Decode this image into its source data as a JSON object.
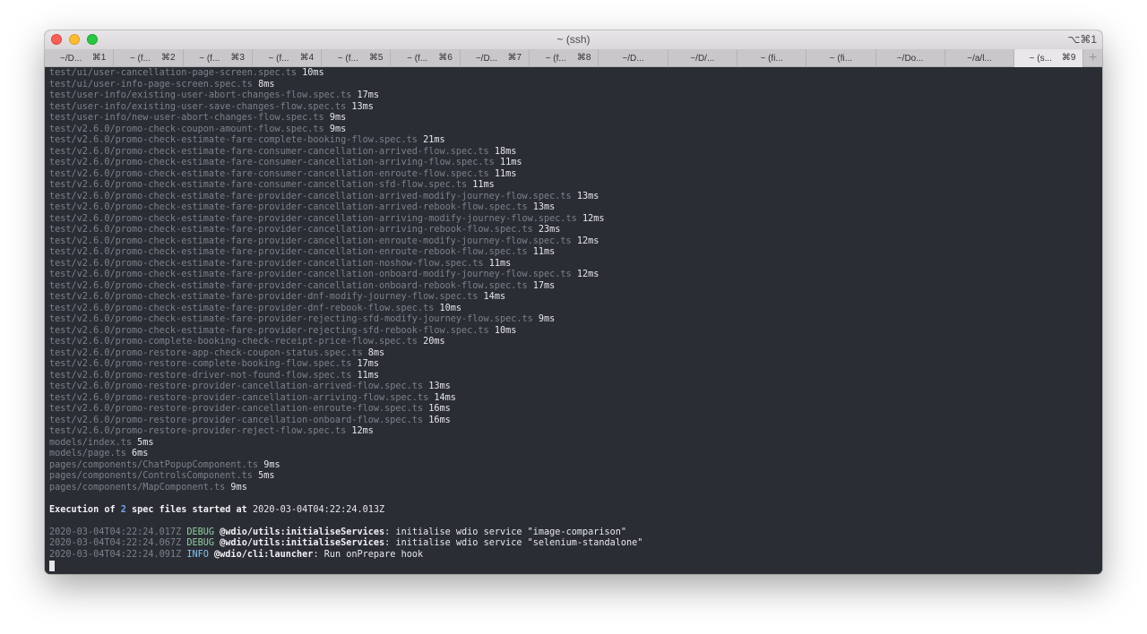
{
  "window": {
    "title": "~ (ssh)",
    "shortcut": "⌥⌘1"
  },
  "tabs": [
    {
      "label": "~/D...",
      "key": "⌘1",
      "active": false
    },
    {
      "label": "~ (f...",
      "key": "⌘2",
      "active": false
    },
    {
      "label": "~ (f...",
      "key": "⌘3",
      "active": false
    },
    {
      "label": "~ (f...",
      "key": "⌘4",
      "active": false
    },
    {
      "label": "~ (f...",
      "key": "⌘5",
      "active": false
    },
    {
      "label": "~ (f...",
      "key": "⌘6",
      "active": false
    },
    {
      "label": "~/D...",
      "key": "⌘7",
      "active": false
    },
    {
      "label": "~ (f...",
      "key": "⌘8",
      "active": false
    },
    {
      "label": "~/D...",
      "key": "",
      "active": false
    },
    {
      "label": "~/D/...",
      "key": "",
      "active": false
    },
    {
      "label": "~ (fi...",
      "key": "",
      "active": false
    },
    {
      "label": "~ (fi...",
      "key": "",
      "active": false
    },
    {
      "label": "~/Do...",
      "key": "",
      "active": false
    },
    {
      "label": "~/a/l...",
      "key": "",
      "active": false
    },
    {
      "label": "~ (s...",
      "key": "⌘9",
      "active": true
    }
  ],
  "add_tab_label": "+",
  "colors": {
    "terminal_bg": "#2b2d35",
    "path_text": "#7c8089",
    "debug": "#8fd19e",
    "info": "#7fc4f0"
  },
  "file_lines": [
    {
      "path": "test/ui/user-cancellation-page-screen.spec.ts",
      "time": "10ms"
    },
    {
      "path": "test/ui/user-info-page-screen.spec.ts",
      "time": "8ms"
    },
    {
      "path": "test/user-info/existing-user-abort-changes-flow.spec.ts",
      "time": "17ms"
    },
    {
      "path": "test/user-info/existing-user-save-changes-flow.spec.ts",
      "time": "13ms"
    },
    {
      "path": "test/user-info/new-user-abort-changes-flow.spec.ts",
      "time": "9ms"
    },
    {
      "path": "test/v2.6.0/promo-check-coupon-amount-flow.spec.ts",
      "time": "9ms"
    },
    {
      "path": "test/v2.6.0/promo-check-estimate-fare-complete-booking-flow.spec.ts",
      "time": "21ms"
    },
    {
      "path": "test/v2.6.0/promo-check-estimate-fare-consumer-cancellation-arrived-flow.spec.ts",
      "time": "18ms"
    },
    {
      "path": "test/v2.6.0/promo-check-estimate-fare-consumer-cancellation-arriving-flow.spec.ts",
      "time": "11ms"
    },
    {
      "path": "test/v2.6.0/promo-check-estimate-fare-consumer-cancellation-enroute-flow.spec.ts",
      "time": "11ms"
    },
    {
      "path": "test/v2.6.0/promo-check-estimate-fare-consumer-cancellation-sfd-flow.spec.ts",
      "time": "11ms"
    },
    {
      "path": "test/v2.6.0/promo-check-estimate-fare-provider-cancellation-arrived-modify-journey-flow.spec.ts",
      "time": "13ms"
    },
    {
      "path": "test/v2.6.0/promo-check-estimate-fare-provider-cancellation-arrived-rebook-flow.spec.ts",
      "time": "13ms"
    },
    {
      "path": "test/v2.6.0/promo-check-estimate-fare-provider-cancellation-arriving-modify-journey-flow.spec.ts",
      "time": "12ms"
    },
    {
      "path": "test/v2.6.0/promo-check-estimate-fare-provider-cancellation-arriving-rebook-flow.spec.ts",
      "time": "23ms"
    },
    {
      "path": "test/v2.6.0/promo-check-estimate-fare-provider-cancellation-enroute-modify-journey-flow.spec.ts",
      "time": "12ms"
    },
    {
      "path": "test/v2.6.0/promo-check-estimate-fare-provider-cancellation-enroute-rebook-flow.spec.ts",
      "time": "11ms"
    },
    {
      "path": "test/v2.6.0/promo-check-estimate-fare-provider-cancellation-noshow-flow.spec.ts",
      "time": "11ms"
    },
    {
      "path": "test/v2.6.0/promo-check-estimate-fare-provider-cancellation-onboard-modify-journey-flow.spec.ts",
      "time": "12ms"
    },
    {
      "path": "test/v2.6.0/promo-check-estimate-fare-provider-cancellation-onboard-rebook-flow.spec.ts",
      "time": "17ms"
    },
    {
      "path": "test/v2.6.0/promo-check-estimate-fare-provider-dnf-modify-journey-flow.spec.ts",
      "time": "14ms"
    },
    {
      "path": "test/v2.6.0/promo-check-estimate-fare-provider-dnf-rebook-flow.spec.ts",
      "time": "10ms"
    },
    {
      "path": "test/v2.6.0/promo-check-estimate-fare-provider-rejecting-sfd-modify-journey-flow.spec.ts",
      "time": "9ms"
    },
    {
      "path": "test/v2.6.0/promo-check-estimate-fare-provider-rejecting-sfd-rebook-flow.spec.ts",
      "time": "10ms"
    },
    {
      "path": "test/v2.6.0/promo-complete-booking-check-receipt-price-flow.spec.ts",
      "time": "20ms"
    },
    {
      "path": "test/v2.6.0/promo-restore-app-check-coupon-status.spec.ts",
      "time": "8ms"
    },
    {
      "path": "test/v2.6.0/promo-restore-complete-booking-flow.spec.ts",
      "time": "17ms"
    },
    {
      "path": "test/v2.6.0/promo-restore-driver-not-found-flow.spec.ts",
      "time": "11ms"
    },
    {
      "path": "test/v2.6.0/promo-restore-provider-cancellation-arrived-flow.spec.ts",
      "time": "13ms"
    },
    {
      "path": "test/v2.6.0/promo-restore-provider-cancellation-arriving-flow.spec.ts",
      "time": "14ms"
    },
    {
      "path": "test/v2.6.0/promo-restore-provider-cancellation-enroute-flow.spec.ts",
      "time": "16ms"
    },
    {
      "path": "test/v2.6.0/promo-restore-provider-cancellation-onboard-flow.spec.ts",
      "time": "16ms"
    },
    {
      "path": "test/v2.6.0/promo-restore-provider-reject-flow.spec.ts",
      "time": "12ms"
    },
    {
      "path": "models/index.ts",
      "time": "5ms"
    },
    {
      "path": "models/page.ts",
      "time": "6ms"
    },
    {
      "path": "pages/components/ChatPopupComponent.ts",
      "time": "9ms"
    },
    {
      "path": "pages/components/ControlsComponent.ts",
      "time": "5ms"
    },
    {
      "path": "pages/components/MapComponent.ts",
      "time": "9ms"
    }
  ],
  "execution": {
    "prefix": "Execution of ",
    "count": "2",
    "middle": " spec files started at ",
    "timestamp": "2020-03-04T04:22:24.013Z"
  },
  "log_lines": [
    {
      "timestamp": "2020-03-04T04:22:24.017Z",
      "level": "DEBUG",
      "source": "@wdio/utils:initialiseServices",
      "message": ": initialise wdio service \"image-comparison\""
    },
    {
      "timestamp": "2020-03-04T04:22:24.067Z",
      "level": "DEBUG",
      "source": "@wdio/utils:initialiseServices",
      "message": ": initialise wdio service \"selenium-standalone\""
    },
    {
      "timestamp": "2020-03-04T04:22:24.091Z",
      "level": "INFO",
      "source": "@wdio/cli:launcher",
      "message": ": Run onPrepare hook"
    }
  ]
}
